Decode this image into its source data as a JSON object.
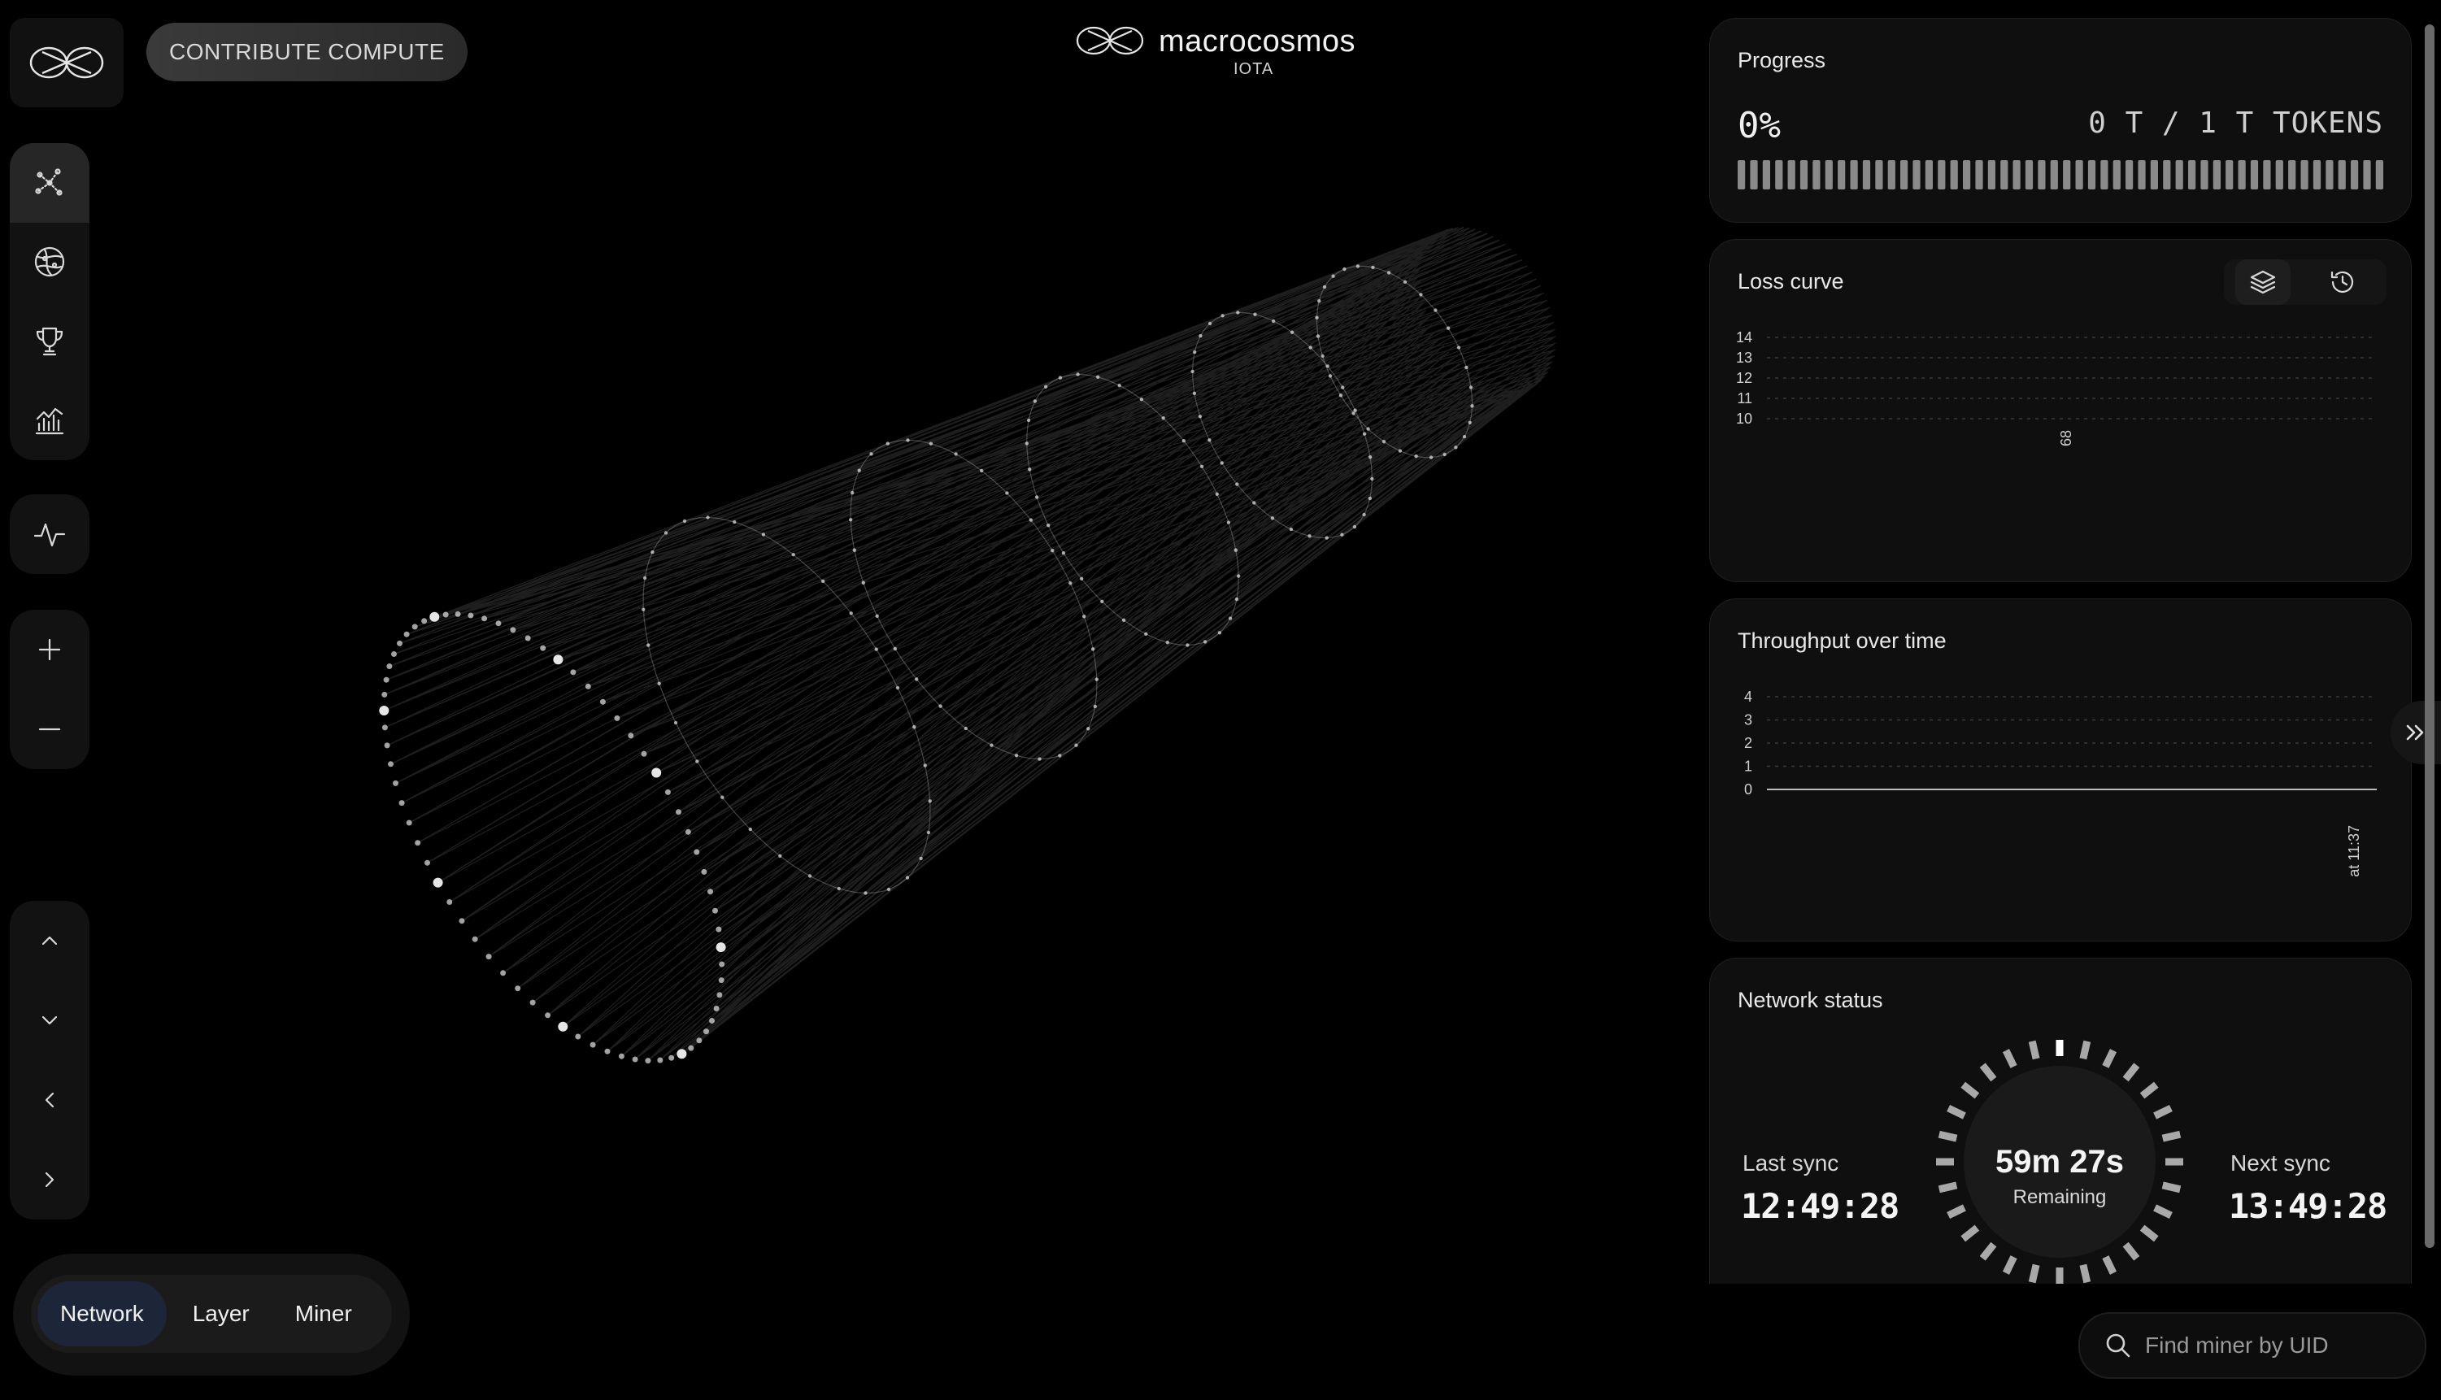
{
  "header": {
    "contribute_label": "CONTRIBUTE COMPUTE",
    "brand_name": "macrocosmos",
    "brand_sub": "IOTA"
  },
  "rail": {
    "nav_icons": [
      "network-graph-icon",
      "globe-icon",
      "trophy-icon",
      "analytics-icon"
    ],
    "activity_icon": "activity-icon",
    "zoom_icons": [
      "plus-icon",
      "minus-icon"
    ],
    "pan_icons": [
      "chevron-up-icon",
      "chevron-down-icon",
      "chevron-left-icon",
      "chevron-right-icon"
    ]
  },
  "view_switch": {
    "options": [
      "Network",
      "Layer",
      "Miner"
    ],
    "selected": "Network"
  },
  "progress": {
    "title": "Progress",
    "percent_text": "0%",
    "tokens_text": "0 T / 1 T TOKENS",
    "fraction": 0.0
  },
  "loss_curve": {
    "title": "Loss curve",
    "buttons": [
      "layers-icon",
      "history-icon"
    ]
  },
  "throughput": {
    "title": "Throughput over time"
  },
  "network_status": {
    "title": "Network status",
    "last_sync_label": "Last sync",
    "last_sync_time": "12:49:28",
    "next_sync_label": "Next sync",
    "next_sync_time": "13:49:28",
    "remaining_time": "59m 27s",
    "remaining_label": "Remaining"
  },
  "search": {
    "placeholder": "Find miner by UID"
  },
  "colors": {
    "background": "#000000",
    "panel": "#0f0f0f",
    "accent_active": "#1d2638",
    "text": "#e8e8e8"
  },
  "chart_data": [
    {
      "type": "line",
      "title": "Loss curve",
      "x": [
        "68"
      ],
      "series": [
        {
          "values": []
        }
      ],
      "yticks": [
        10,
        11,
        12,
        13,
        14
      ],
      "ylim": [
        10,
        14
      ],
      "grid": true
    },
    {
      "type": "line",
      "title": "Throughput over time",
      "x": [
        "at 11:37"
      ],
      "series": [
        {
          "values": [
            0
          ]
        }
      ],
      "yticks": [
        0,
        1,
        2,
        3,
        4
      ],
      "ylim": [
        0,
        4
      ],
      "grid": true
    }
  ]
}
